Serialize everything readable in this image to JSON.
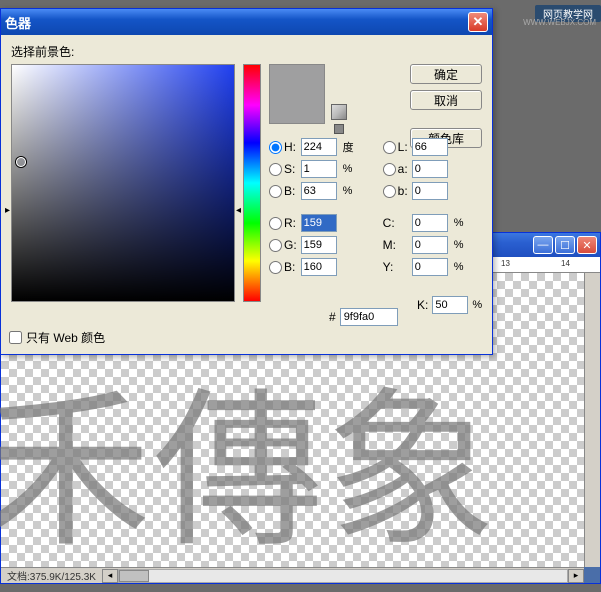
{
  "watermark": {
    "label": "网页教学网",
    "url": "WWW.WEBJX.COM"
  },
  "canvasWindow": {
    "doc_info": "文档:375.9K/125.3K",
    "ruler": {
      "m13": "13",
      "m14": "14"
    }
  },
  "dialog": {
    "title": "色器",
    "prompt": "选择前景色:",
    "buttons": {
      "ok": "确定",
      "cancel": "取消",
      "lib": "颜色库"
    },
    "hsb": {
      "h_label": "H:",
      "h_val": "224",
      "h_unit": "度",
      "s_label": "S:",
      "s_val": "1",
      "s_unit": "%",
      "b_label": "B:",
      "b_val": "63",
      "b_unit": "%"
    },
    "lab": {
      "l_label": "L:",
      "l_val": "66",
      "a_label": "a:",
      "a_val": "0",
      "b_label": "b:",
      "b_val": "0"
    },
    "rgb": {
      "r_label": "R:",
      "r_val": "159",
      "g_label": "G:",
      "g_val": "159",
      "b_label": "B:",
      "b_val": "160"
    },
    "cmyk": {
      "c_label": "C:",
      "c_val": "0",
      "c_unit": "%",
      "m_label": "M:",
      "m_val": "0",
      "m_unit": "%",
      "y_label": "Y:",
      "y_val": "0",
      "y_unit": "%",
      "k_label": "K:",
      "k_val": "50",
      "k_unit": "%"
    },
    "hex_label": "#",
    "hex_val": "9f9fa0",
    "web_only": "只有 Web 颜色"
  }
}
